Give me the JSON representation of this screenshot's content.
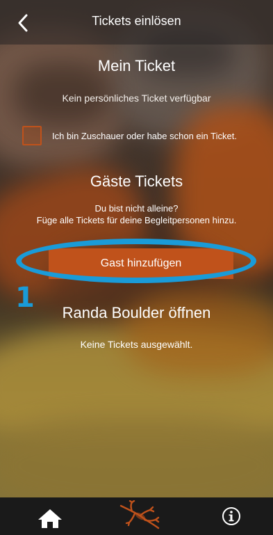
{
  "nav": {
    "title": "Tickets einlösen",
    "back_icon": "chevron-left-icon"
  },
  "mein_ticket": {
    "heading": "Mein Ticket",
    "empty_text": "Kein persönliches Ticket verfügbar",
    "checkbox_label": "Ich bin Zuschauer oder habe schon ein Ticket.",
    "checkbox_checked": false
  },
  "gaeste_tickets": {
    "heading": "Gäste Tickets",
    "description_line1": "Du bist nicht alleine?",
    "description_line2": "Füge alle Tickets für deine Begleitpersonen hinzu.",
    "button_label": "Gast hinzufügen"
  },
  "annotation": {
    "marker_number": "1",
    "color": "#1a9bd8"
  },
  "open_section": {
    "heading": "Randa Boulder öffnen",
    "empty_text": "Keine Tickets ausgewählt."
  },
  "tabbar": {
    "items": [
      {
        "icon": "home-icon"
      },
      {
        "icon": "lizard-logo-icon"
      },
      {
        "icon": "info-icon"
      }
    ]
  },
  "colors": {
    "accent": "#c0521b",
    "tabbar_bg": "#1a1a1a",
    "text": "#ffffff"
  }
}
